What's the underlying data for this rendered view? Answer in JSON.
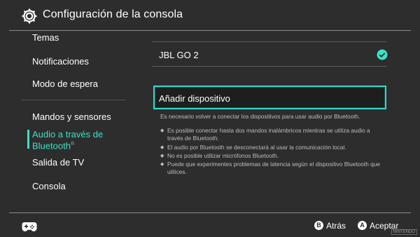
{
  "header": {
    "title": "Configuración de la consola",
    "icon": "gear-icon"
  },
  "sidebar": {
    "items": [
      {
        "label": "Temas"
      },
      {
        "label": "Notificaciones"
      },
      {
        "label": "Modo de espera"
      },
      {
        "label": "Mandos y sensores"
      },
      {
        "label": "Audio a través de",
        "label_line2": "Bluetooth",
        "superscript": "®",
        "active": true
      },
      {
        "label": "Salida de TV"
      },
      {
        "label": "Consola"
      }
    ]
  },
  "main": {
    "device": {
      "name": "JBL GO 2",
      "connected_icon": "check-circle-icon"
    },
    "add_button_label": "Añadir dispositivo",
    "note": "Es necesario volver a conectar los dispositivos para usar audio por Bluetooth.",
    "bullets": [
      "Es posible conectar hasta dos mandos inalámbricos mientras se utiliza audio a través de Bluetooth.",
      "El audio por Bluetooth se desconectará al usar la comunicación local.",
      "No es posible utilizar micrófonos Bluetooth.",
      "Puede que experimentes problemas de latencia según el dispositivo Bluetooth que utilices."
    ]
  },
  "footer": {
    "back": {
      "button": "B",
      "label": "Atrás"
    },
    "accept": {
      "button": "A",
      "label": "Aceptar"
    },
    "controller_icon": "controller-icon",
    "watermark": "NINTENDO"
  },
  "colors": {
    "background": "#2d2d2d",
    "accent": "#3ee0c4",
    "text": "#ffffff",
    "muted": "#bdbdbd"
  }
}
